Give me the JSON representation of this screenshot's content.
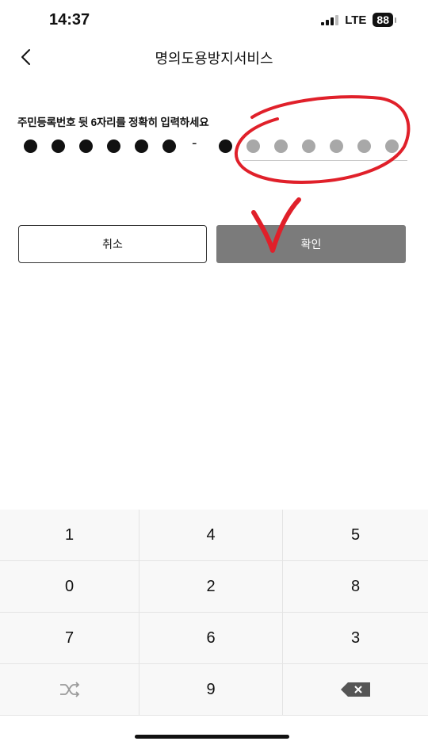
{
  "status_bar": {
    "time": "14:37",
    "network": "LTE",
    "battery": "88"
  },
  "nav": {
    "back_icon": "chevron-left-icon",
    "title": "명의도용방지서비스"
  },
  "form": {
    "prompt": "주민등록번호 뒷 6자리를 정확히 입력하세요",
    "front_digits_entered": 6,
    "back_digits_entered": 1,
    "back_digits_total": 7,
    "separator": "-"
  },
  "buttons": {
    "cancel": "취소",
    "confirm": "확인"
  },
  "annotation": {
    "color": "#e0202a",
    "marks": [
      "circle",
      "checkmark"
    ]
  },
  "keypad": {
    "keys": [
      {
        "label": "1"
      },
      {
        "label": "4"
      },
      {
        "label": "5"
      },
      {
        "label": "0"
      },
      {
        "label": "2"
      },
      {
        "label": "8"
      },
      {
        "label": "7"
      },
      {
        "label": "6"
      },
      {
        "label": "3"
      },
      {
        "label": "",
        "icon": "shuffle-icon"
      },
      {
        "label": "9"
      },
      {
        "label": "",
        "icon": "backspace-icon"
      }
    ]
  }
}
